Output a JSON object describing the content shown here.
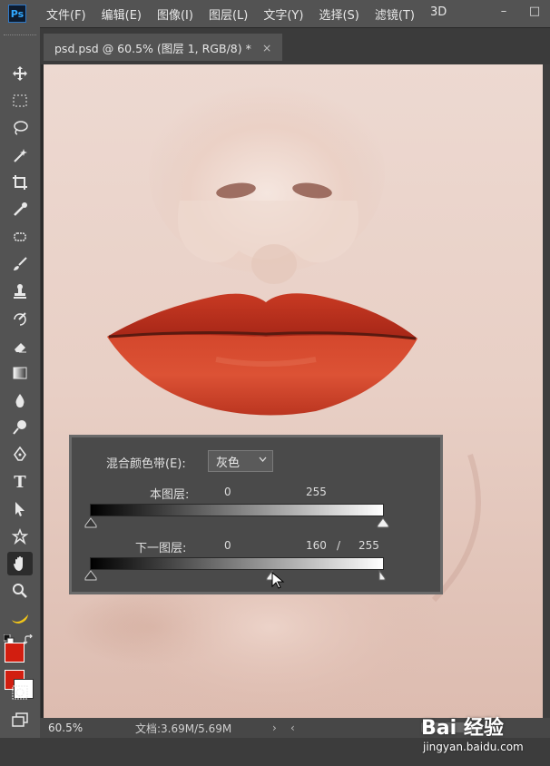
{
  "app": {
    "logo": "Ps"
  },
  "menu": [
    "文件(F)",
    "编辑(E)",
    "图像(I)",
    "图层(L)",
    "文字(Y)",
    "选择(S)",
    "滤镜(T)",
    "3D"
  ],
  "window_controls": {
    "minimize": "–",
    "maximize": "□"
  },
  "document_tab": {
    "title": "psd.psd @ 60.5% (图层 1, RGB/8) *",
    "close": "×"
  },
  "tools": [
    "move-icon",
    "marquee-icon",
    "lasso-icon",
    "magic-wand-icon",
    "crop-icon",
    "eyedropper-icon",
    "healing-brush-icon",
    "brush-icon",
    "clone-stamp-icon",
    "history-brush-icon",
    "eraser-icon",
    "gradient-icon",
    "blur-icon",
    "dodge-icon",
    "pen-icon",
    "type-icon",
    "path-selection-icon",
    "shape-icon",
    "hand-icon",
    "zoom-icon",
    "banana-icon"
  ],
  "colors": {
    "foreground": "#d21e10",
    "background": "#ffffff"
  },
  "blend_if": {
    "label": "混合颜色带(E):",
    "channel": "灰色",
    "this_layer": {
      "label": "本图层:",
      "black": "0",
      "white": "255"
    },
    "underlying_layer": {
      "label": "下一图层:",
      "black": "0",
      "white_split": "160",
      "separator": "/",
      "white": "255"
    }
  },
  "status": {
    "zoom": "60.5%",
    "doc_info": "文档:3.69M/5.69M",
    "arrow": "›",
    "left_arrow": "‹"
  },
  "watermark": {
    "brand": "Bai 经验",
    "url": "jingyan.baidu.com"
  }
}
